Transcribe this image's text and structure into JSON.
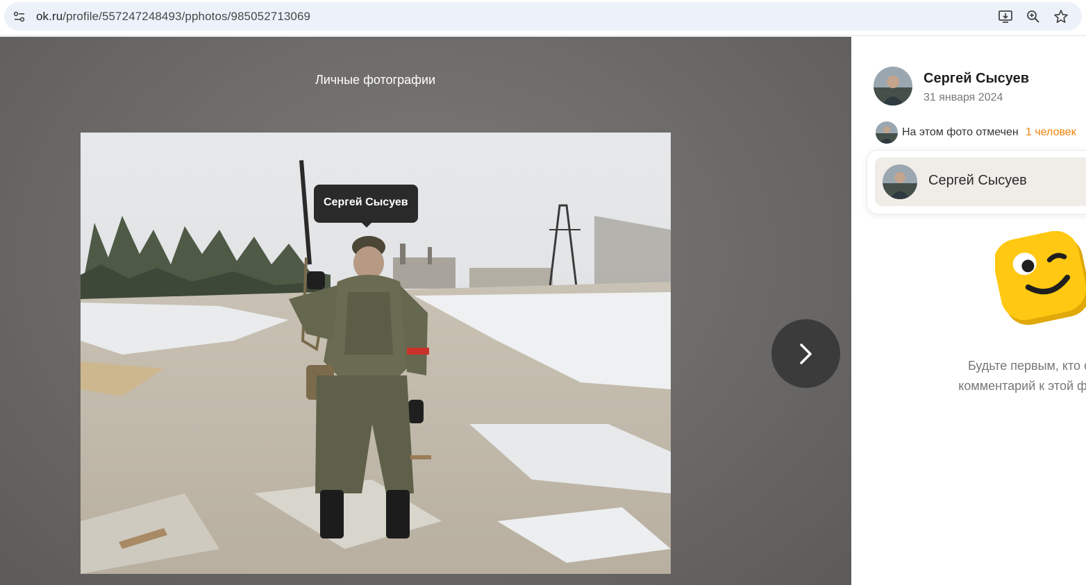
{
  "browser": {
    "url_host": "ok.ru",
    "url_path": "/profile/557247248493/pphotos/985052713069",
    "icons": [
      "site-settings-icon",
      "install-app-icon",
      "zoom-icon",
      "bookmark-star-icon"
    ]
  },
  "viewer": {
    "album_title": "Личные фотографии",
    "photo_tag_label": "Сергей Сысуев",
    "next_icon": "chevron-right-icon"
  },
  "panel": {
    "author_name": "Сергей Сысуев",
    "post_date": "31 января 2024",
    "tagged_prefix": "На этом фото отмечен",
    "tagged_count": "1 человек",
    "tagged_people": [
      {
        "name": "Сергей Сысуев"
      }
    ],
    "empty_comments_line1": "Будьте первым, кто с",
    "empty_comments_line2": "комментарий к этой фот"
  },
  "colors": {
    "accent_orange": "#ee8208",
    "viewer_bg": "#6f6d6b",
    "tooltip_bg": "#2a2a2a",
    "mascot_yellow": "#ffc812"
  }
}
